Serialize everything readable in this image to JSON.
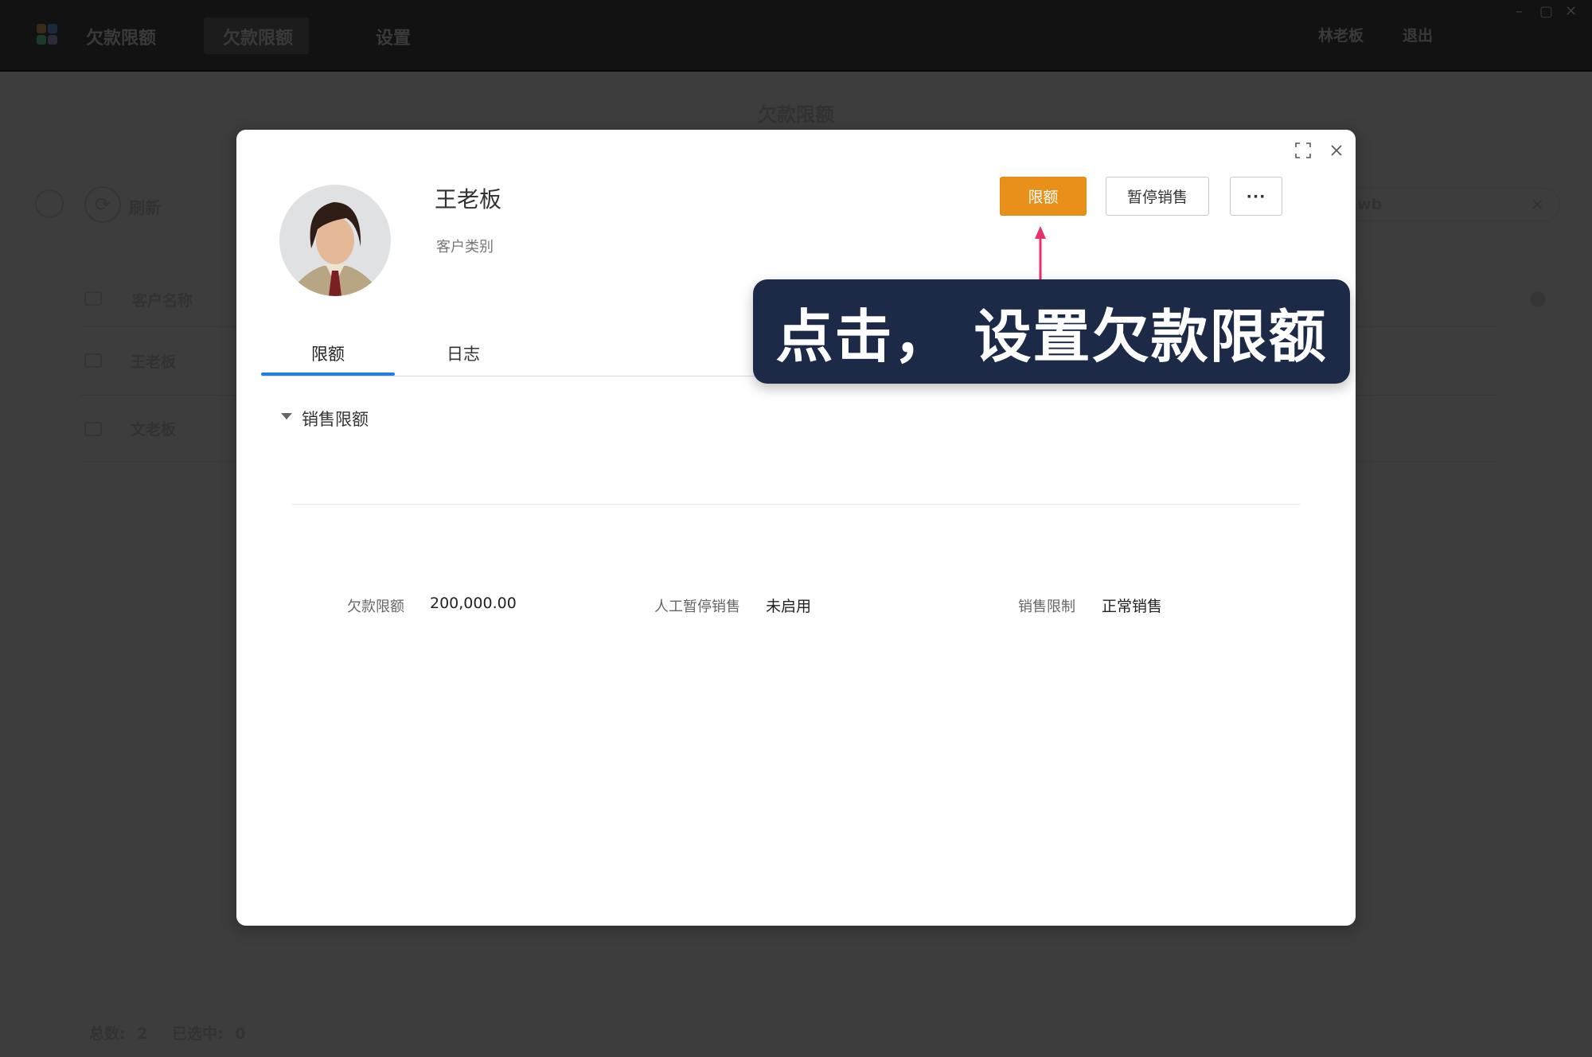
{
  "topbar": {
    "app_title": "欠款限额",
    "tabs": [
      {
        "label": "欠款限额",
        "active": true
      },
      {
        "label": "设置"
      }
    ],
    "user": "林老板",
    "logout": "退出"
  },
  "page": {
    "title": "欠款限额",
    "refresh": "刷新",
    "search_value": "wb",
    "columns": [
      "客户名称"
    ],
    "rows": [
      "王老板",
      "文老板"
    ],
    "footer": {
      "total_label": "总数:",
      "total": "2",
      "selected_label": "已选中:",
      "selected": "0"
    }
  },
  "modal": {
    "customer_name": "王老板",
    "customer_category_label": "客户类别",
    "buttons": {
      "limit": "限额",
      "suspend": "暂停销售",
      "more": "···"
    },
    "tabs": [
      {
        "label": "限额",
        "active": true
      },
      {
        "label": "日志"
      }
    ],
    "section": {
      "title": "销售限额",
      "fields": [
        {
          "label": "欠款限额",
          "value": "200,000.00"
        },
        {
          "label": "人工暂停销售",
          "value": "未启用"
        },
        {
          "label": "销售限制",
          "value": "正常销售"
        }
      ]
    }
  },
  "callout": {
    "text": "点击， 设置欠款限额"
  },
  "colors": {
    "accent": "#e8901a",
    "tab_active": "#1e7fe0",
    "callout_bg": "#1c2a48",
    "arrow": "#e8306a"
  }
}
